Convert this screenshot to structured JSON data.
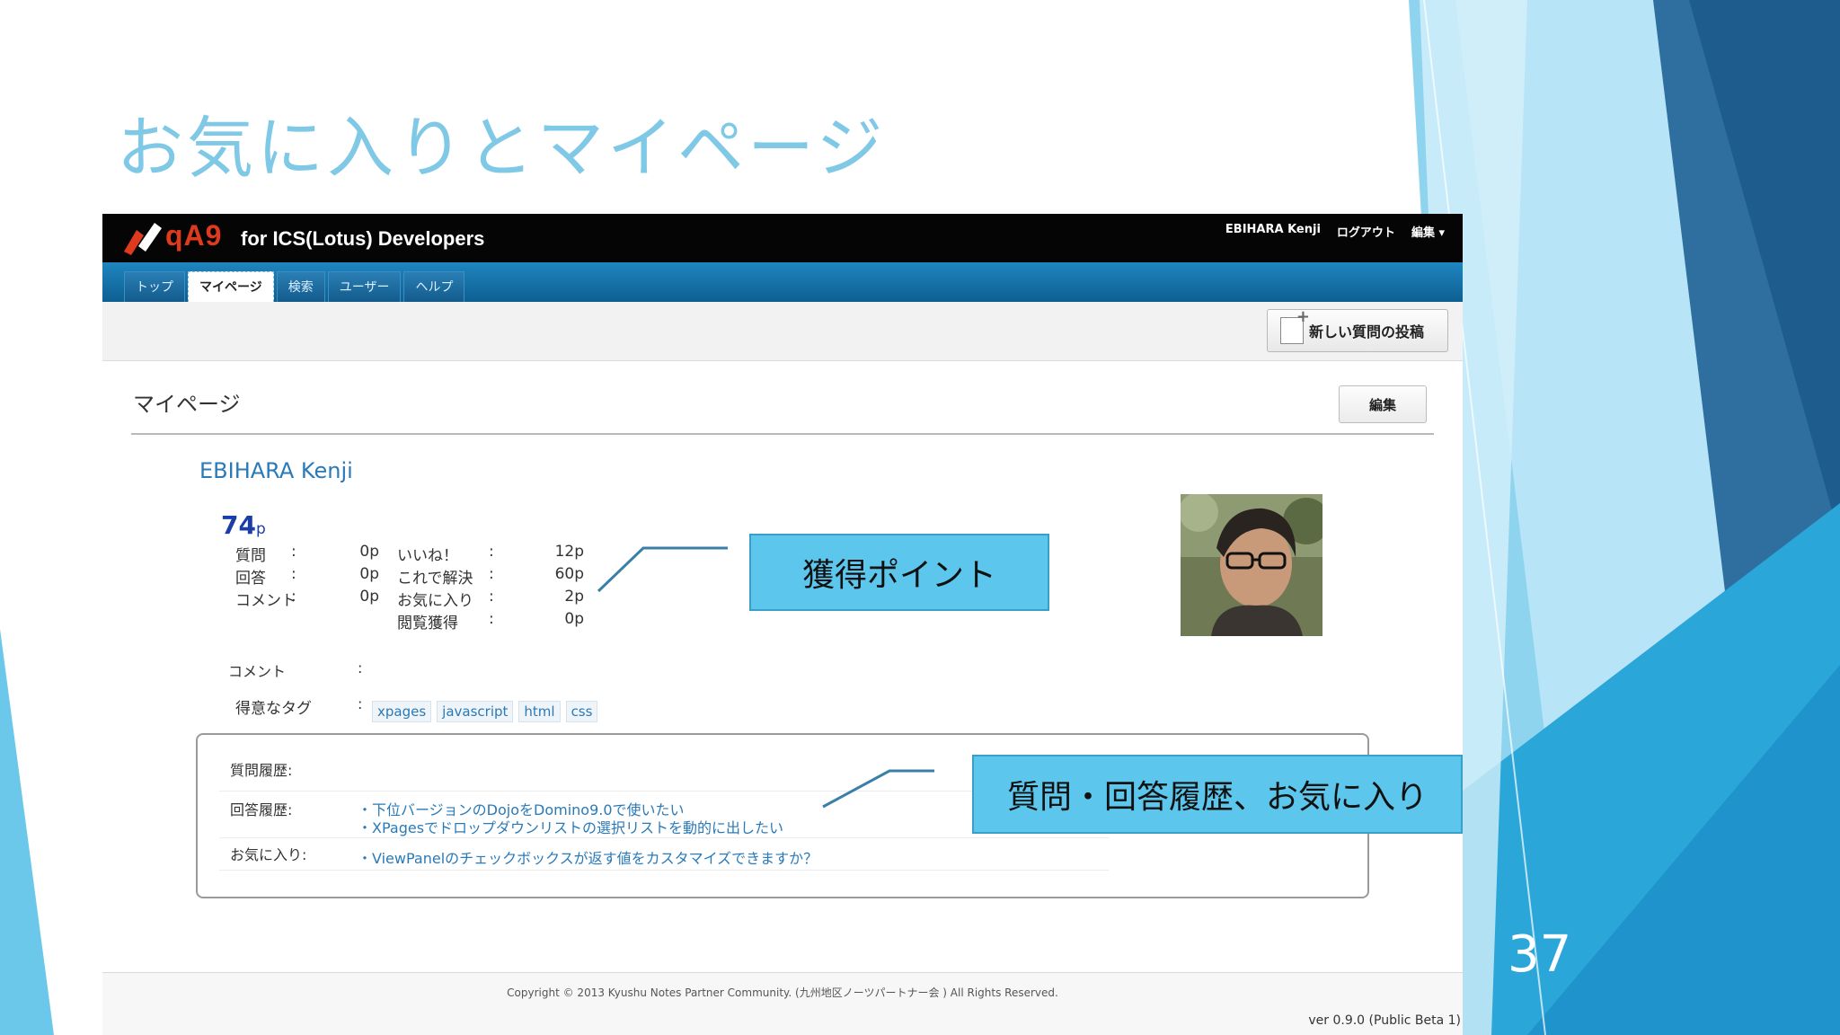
{
  "slide": {
    "title": "お気に入りとマイページ",
    "number": "37"
  },
  "app": {
    "logo": "qA9",
    "subtitle": "for ICS(Lotus) Developers",
    "user_menu": {
      "user": "EBIHARA Kenji",
      "logout": "ログアウト",
      "edit": "編集 ▾"
    },
    "tabs": [
      {
        "label": "トップ"
      },
      {
        "label": "マイページ",
        "active": true
      },
      {
        "label": "検索"
      },
      {
        "label": "ユーザー"
      },
      {
        "label": "ヘルプ"
      }
    ],
    "new_post_button": "新しい質問の投稿",
    "page_heading": "マイページ",
    "edit_button": "編集",
    "profile": {
      "name": "EBIHARA Kenji",
      "points_total": "74",
      "points_unit": "p",
      "stats_left": [
        {
          "label": "質問",
          "value": "0p"
        },
        {
          "label": "回答",
          "value": "0p"
        },
        {
          "label": "コメント",
          "value": "0p"
        }
      ],
      "stats_right": [
        {
          "label": "いいね！",
          "value": "12p"
        },
        {
          "label": "これで解決",
          "value": "60p"
        },
        {
          "label": "お気に入り",
          "value": "2p"
        },
        {
          "label": "閲覧獲得",
          "value": "0p"
        }
      ],
      "comment_label": "コメント",
      "tags_label": "得意なタグ",
      "tags": [
        "xpages",
        "javascript",
        "html",
        "css"
      ]
    },
    "history": {
      "questions_label": "質問履歴:",
      "answers_label": "回答履歴:",
      "answers": [
        "・下位バージョンのDojoをDomino9.0で使いたい",
        "・XPagesでドロップダウンリストの選択リストを動的に出したい"
      ],
      "favorites_label": "お気に入り:",
      "favorites": [
        "・ViewPanelのチェックボックスが返す値をカスタマイズできますか？"
      ]
    },
    "footer": {
      "copyright": "Copyright © 2013 Kyushu Notes Partner Community. (九州地区ノーツパートナー会 ) All Rights Reserved.",
      "version": "ver 0.9.0 (Public Beta 1)"
    }
  },
  "callouts": {
    "points": "獲得ポイント",
    "history": "質問・回答履歴、お気に入り"
  },
  "colors": {
    "title": "#7fc9e6",
    "nav_blue": "#1672a8",
    "callout_fill": "#5cc6ec",
    "link": "#2a7ab8"
  }
}
